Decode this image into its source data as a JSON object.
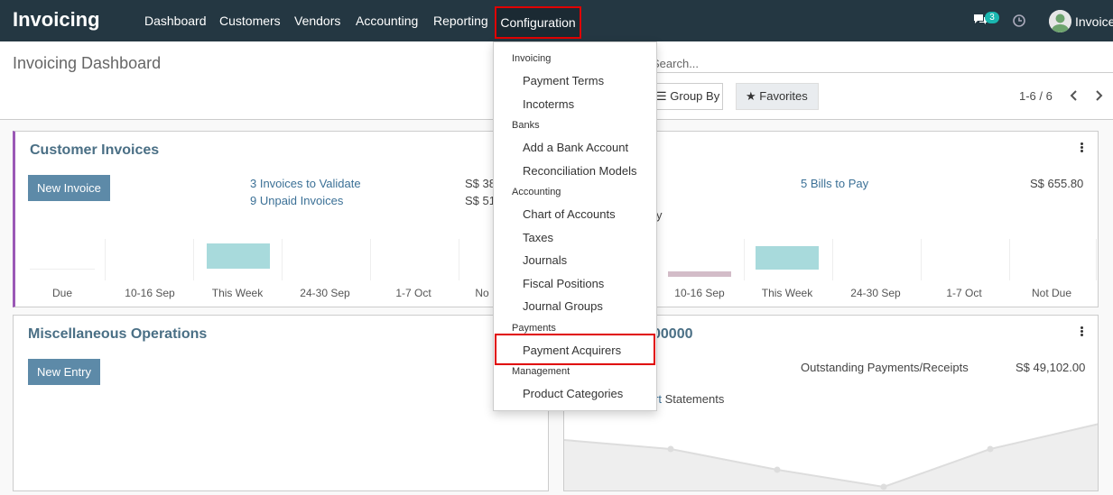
{
  "app": {
    "title": "Invoicing"
  },
  "nav": {
    "items": [
      "Dashboard",
      "Customers",
      "Vendors",
      "Accounting",
      "Reporting",
      "Configuration"
    ],
    "active": "Configuration",
    "chat_count": "3",
    "user": "Invoice"
  },
  "control_panel": {
    "title": "Invoicing Dashboard",
    "search_placeholder": "Search...",
    "group_by": "Group By",
    "favorites": "Favorites",
    "pager": "1-6 / 6"
  },
  "customer_invoices": {
    "title": "Customer Invoices",
    "button": "New Invoice",
    "links": [
      "3 Invoices to Validate",
      "9 Unpaid Invoices"
    ],
    "amounts": [
      "S$ 38",
      "S$ 51"
    ],
    "chart_labels": [
      "Due",
      "10-16 Sep",
      "This Week",
      "24-30 Sep",
      "1-7 Oct",
      "No"
    ]
  },
  "vendor_bills": {
    "link": "5 Bills to Pay",
    "amount": "S$ 655.80",
    "partial_text": "y",
    "chart_labels": [
      "10-16 Sep",
      "This Week",
      "24-30 Sep",
      "1-7 Oct",
      "Not Due"
    ]
  },
  "misc_operations": {
    "title": "Miscellaneous Operations",
    "button": "New Entry"
  },
  "bank": {
    "title": "00000",
    "label": "Outstanding Payments/Receipts",
    "amount": "S$ 49,102.00",
    "statements_prefix": "rt",
    "statements": " Statements"
  },
  "dropdown": {
    "sections": [
      {
        "header": "Invoicing",
        "items": [
          "Payment Terms",
          "Incoterms"
        ]
      },
      {
        "header": "Banks",
        "items": [
          "Add a Bank Account",
          "Reconciliation Models"
        ]
      },
      {
        "header": "Accounting",
        "items": [
          "Chart of Accounts",
          "Taxes",
          "Journals",
          "Fiscal Positions",
          "Journal Groups"
        ]
      },
      {
        "header": "Payments",
        "items": [
          "Payment Acquirers"
        ]
      },
      {
        "header": "Management",
        "items": [
          "Product Categories"
        ]
      }
    ],
    "highlighted": "Payment Acquirers"
  },
  "colors": {
    "navbar": "#243742",
    "accent": "#5d8aa8",
    "highlight_border": "#e00000",
    "bar_teal": "#a8dadc",
    "bar_mauve": "#d3bcc8"
  }
}
